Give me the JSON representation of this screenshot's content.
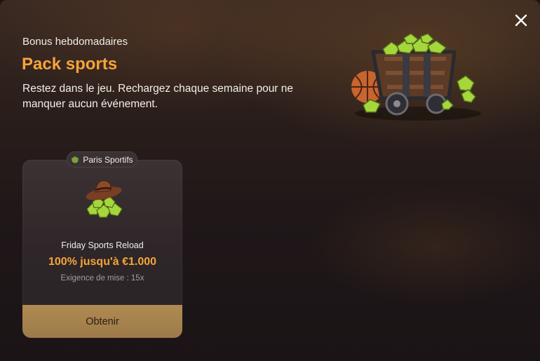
{
  "modal": {
    "eyebrow": "Bonus hebdomadaires",
    "title": "Pack sports",
    "description": "Restez dans le jeu. Rechargez chaque semaine pour ne manquer aucun événement.",
    "hero_icon": "mine-cart-gems-basketball",
    "close_icon": "close-icon"
  },
  "card": {
    "tag": "Paris Sportifs",
    "tag_icon": "gem-icon",
    "art_icon": "cowboy-hat-gems",
    "name": "Friday Sports Reload",
    "offer": "100% jusqu'à €1.000",
    "requirement": "Exigence de mise : 15x",
    "claim_label": "Obtenir"
  },
  "colors": {
    "accent": "#f5a43a",
    "button": "#a8844e",
    "gem": "#a5d63b"
  }
}
